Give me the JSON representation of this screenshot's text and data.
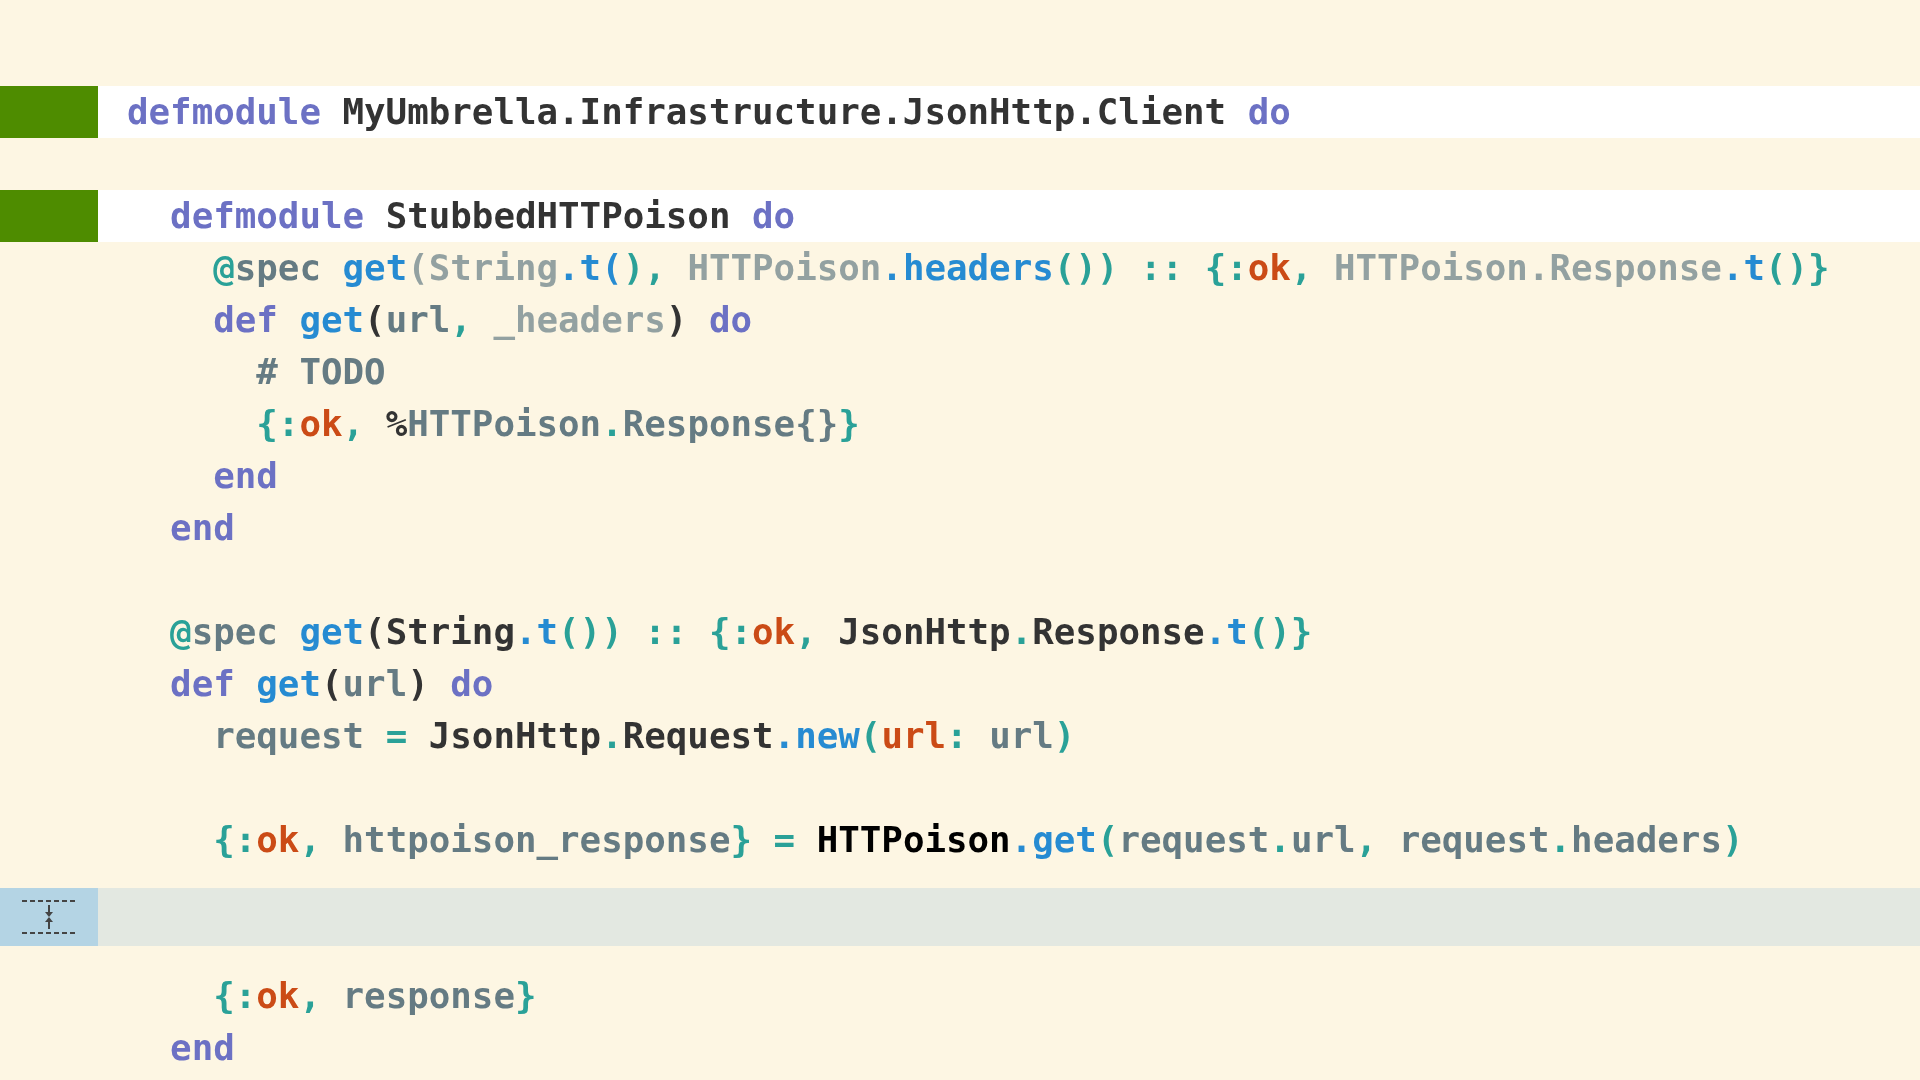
{
  "lines": [
    {
      "kind": "added",
      "tokens": [
        {
          "t": "defmodule ",
          "kind": "kw"
        },
        {
          "t": "MyUmbrella.Infrastructure.JsonHttp.Client ",
          "kind": "mod"
        },
        {
          "t": "do",
          "kind": "kw"
        }
      ]
    },
    {
      "kind": "blank"
    },
    {
      "kind": "added",
      "tokens": [
        {
          "t": "  defmodule ",
          "kind": "kw"
        },
        {
          "t": "StubbedHTTPoison ",
          "kind": "mod"
        },
        {
          "t": "do",
          "kind": "kw"
        }
      ]
    },
    {
      "kind": "normal",
      "tokens": [
        {
          "t": "    @",
          "kind": "punct"
        },
        {
          "t": "spec ",
          "kind": "text"
        },
        {
          "t": "get",
          "kind": "fn"
        },
        {
          "t": "(String",
          "kind": "dim"
        },
        {
          "t": ".t(",
          "kind": "fn"
        },
        {
          "t": "), ",
          "kind": "punct"
        },
        {
          "t": "HTTPoison",
          "kind": "dim"
        },
        {
          "t": ".headers",
          "kind": "fn"
        },
        {
          "t": "()) :: {:",
          "kind": "punct"
        },
        {
          "t": "ok",
          "kind": "atom"
        },
        {
          "t": ", ",
          "kind": "punct"
        },
        {
          "t": "HTTPoison.Response",
          "kind": "dim"
        },
        {
          "t": ".t",
          "kind": "fn"
        },
        {
          "t": "()}",
          "kind": "punct"
        }
      ]
    },
    {
      "kind": "normal",
      "tokens": [
        {
          "t": "    def ",
          "kind": "kw"
        },
        {
          "t": "get",
          "kind": "fn"
        },
        {
          "t": "(",
          "kind": "mod"
        },
        {
          "t": "url",
          "kind": "text"
        },
        {
          "t": ", ",
          "kind": "punct"
        },
        {
          "t": "_headers",
          "kind": "dim"
        },
        {
          "t": ") ",
          "kind": "mod"
        },
        {
          "t": "do",
          "kind": "kw"
        }
      ]
    },
    {
      "kind": "normal",
      "tokens": [
        {
          "t": "      # TODO",
          "kind": "text"
        }
      ]
    },
    {
      "kind": "normal",
      "tokens": [
        {
          "t": "      {:",
          "kind": "punct"
        },
        {
          "t": "ok",
          "kind": "atom"
        },
        {
          "t": ", ",
          "kind": "punct"
        },
        {
          "t": "%",
          "kind": "mod"
        },
        {
          "t": "HTTPoison",
          "kind": "text"
        },
        {
          "t": ".",
          "kind": "punct"
        },
        {
          "t": "Response{}",
          "kind": "text"
        },
        {
          "t": "}",
          "kind": "punct"
        }
      ]
    },
    {
      "kind": "normal",
      "tokens": [
        {
          "t": "    end",
          "kind": "kw"
        }
      ]
    },
    {
      "kind": "normal",
      "tokens": [
        {
          "t": "  end",
          "kind": "kw"
        }
      ]
    },
    {
      "kind": "blank"
    },
    {
      "kind": "normal",
      "tokens": [
        {
          "t": "  @",
          "kind": "punct"
        },
        {
          "t": "spec ",
          "kind": "text"
        },
        {
          "t": "get",
          "kind": "fn"
        },
        {
          "t": "(String",
          "kind": "mod"
        },
        {
          "t": ".t",
          "kind": "fn"
        },
        {
          "t": "()) :: {:",
          "kind": "punct"
        },
        {
          "t": "ok",
          "kind": "atom"
        },
        {
          "t": ", ",
          "kind": "punct"
        },
        {
          "t": "JsonHttp",
          "kind": "mod"
        },
        {
          "t": ".",
          "kind": "punct"
        },
        {
          "t": "Response",
          "kind": "mod"
        },
        {
          "t": ".t",
          "kind": "fn"
        },
        {
          "t": "()}",
          "kind": "punct"
        }
      ]
    },
    {
      "kind": "normal",
      "tokens": [
        {
          "t": "  def ",
          "kind": "kw"
        },
        {
          "t": "get",
          "kind": "fn"
        },
        {
          "t": "(",
          "kind": "mod"
        },
        {
          "t": "url",
          "kind": "text"
        },
        {
          "t": ") ",
          "kind": "mod"
        },
        {
          "t": "do",
          "kind": "kw"
        }
      ]
    },
    {
      "kind": "normal",
      "tokens": [
        {
          "t": "    request ",
          "kind": "text"
        },
        {
          "t": "= ",
          "kind": "punct"
        },
        {
          "t": "JsonHttp",
          "kind": "mod"
        },
        {
          "t": ".",
          "kind": "punct"
        },
        {
          "t": "Request",
          "kind": "mod"
        },
        {
          "t": ".new",
          "kind": "fn"
        },
        {
          "t": "(",
          "kind": "punct"
        },
        {
          "t": "url",
          "kind": "atom"
        },
        {
          "t": ": ",
          "kind": "punct"
        },
        {
          "t": "url",
          "kind": "text"
        },
        {
          "t": ")",
          "kind": "punct"
        }
      ]
    },
    {
      "kind": "blank"
    },
    {
      "kind": "normal",
      "tokens": [
        {
          "t": "    {:",
          "kind": "punct"
        },
        {
          "t": "ok",
          "kind": "atom"
        },
        {
          "t": ", ",
          "kind": "punct"
        },
        {
          "t": "httpoison_response",
          "kind": "text"
        },
        {
          "t": "} = ",
          "kind": "punct"
        },
        {
          "t": "HTTPoison",
          "kind": "strong"
        },
        {
          "t": ".get",
          "kind": "fn"
        },
        {
          "t": "(",
          "kind": "punct"
        },
        {
          "t": "request",
          "kind": "text"
        },
        {
          "t": ".",
          "kind": "punct"
        },
        {
          "t": "url",
          "kind": "text"
        },
        {
          "t": ", ",
          "kind": "punct"
        },
        {
          "t": "request",
          "kind": "text"
        },
        {
          "t": ".",
          "kind": "punct"
        },
        {
          "t": "headers",
          "kind": "text"
        },
        {
          "t": ")",
          "kind": "punct"
        }
      ]
    },
    {
      "kind": "collapsed"
    },
    {
      "kind": "normal",
      "tokens": [
        {
          "t": "    {:",
          "kind": "punct"
        },
        {
          "t": "ok",
          "kind": "atom"
        },
        {
          "t": ", ",
          "kind": "punct"
        },
        {
          "t": "response",
          "kind": "text"
        },
        {
          "t": "}",
          "kind": "punct"
        }
      ]
    },
    {
      "kind": "normal",
      "tokens": [
        {
          "t": "  end",
          "kind": "kw"
        }
      ]
    }
  ]
}
